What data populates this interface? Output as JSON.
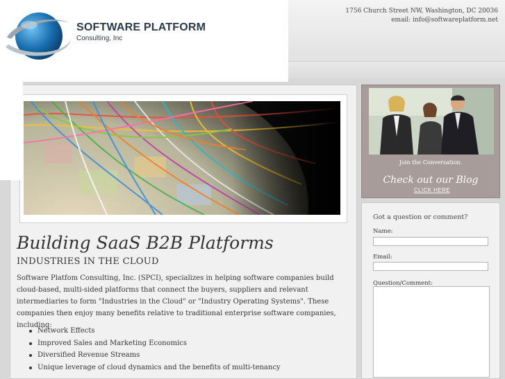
{
  "header": {
    "address": "1756 Church Street NW, Washington, DC 20036",
    "email": "email: info@softwareplatform.net"
  },
  "logo": {
    "name_line1": "SOFTWARE PLATFORM",
    "name_line2": "Consulting, Inc"
  },
  "main": {
    "headline": "Building SaaS B2B Platforms",
    "subheadline": "INDUSTRIES IN THE CLOUD",
    "body": "Software Platfom Consulting, Inc.  (SPCI), specializes in helping software companies build cloud-based, multi-sided platforms that connect the buyers, suppliers and relevant intermediaries to form \"Industries in the Cloud\" or \"Industry Operating Systems\".  These companies then enjoy many benefits relative to traditional enterprise software companies, including:",
    "benefits": [
      "Network Effects",
      "Improved  Sales and Marketing Economics",
      "Diversified Revenue Streams",
      "Unique leverage of cloud dynamics and the benefits of multi-tenancy"
    ]
  },
  "blog": {
    "join_text": "Join the Conversation.",
    "cta_text": "Check out our Blog",
    "link_text": "CLICK HERE"
  },
  "form": {
    "title": "Got a question or comment?",
    "name_label": "Name:",
    "name_value": "",
    "email_label": "Email:",
    "email_value": "",
    "question_label": "Question/Comment:",
    "question_value": ""
  },
  "colors": {
    "blog_box": "#a79c99",
    "logo_blue": "#1a6fb0",
    "text": "#333333"
  },
  "icons": {
    "logo": "globe-swoosh-logo"
  }
}
